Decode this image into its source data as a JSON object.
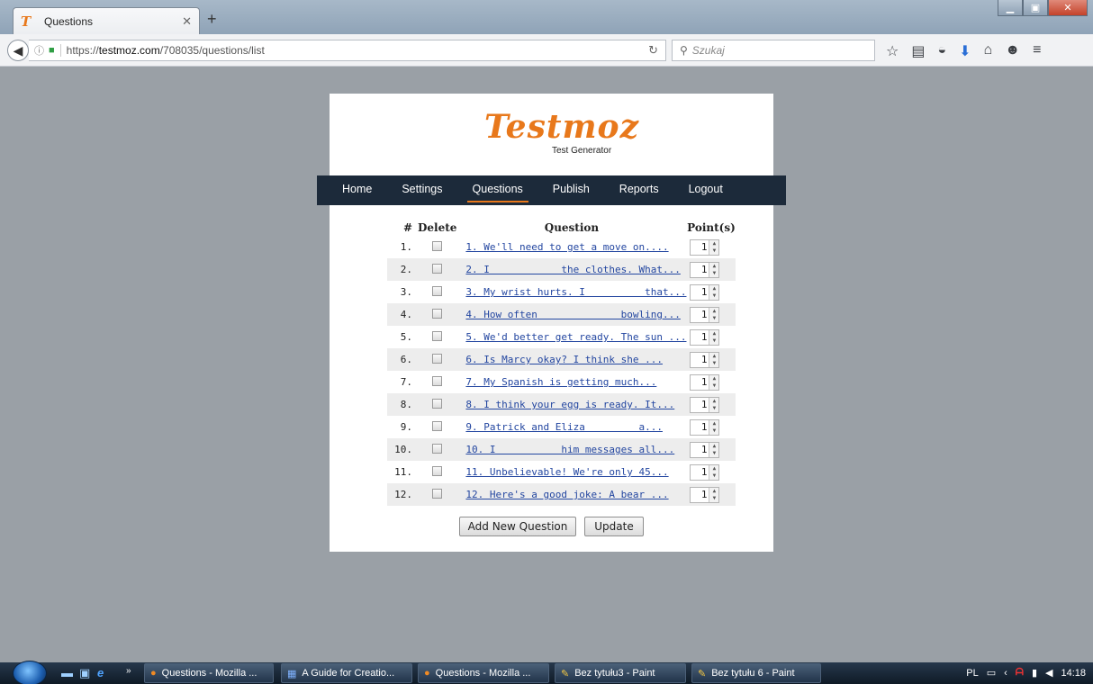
{
  "browser": {
    "tab_title": "Questions",
    "url_prefix": "https://",
    "url_domain": "testmoz.com",
    "url_path": "/708035/questions/list",
    "search_placeholder": "Szukaj"
  },
  "site": {
    "logo": "Testmoz",
    "subtitle": "Test Generator",
    "menu": [
      "Home",
      "Settings",
      "Questions",
      "Publish",
      "Reports",
      "Logout"
    ],
    "active_menu": "Questions"
  },
  "table": {
    "headers": [
      "#",
      "Delete",
      "Question",
      "Point(s)"
    ],
    "rows": [
      {
        "num": "1.",
        "text": "1. We'll need to get a move on....",
        "points": "1"
      },
      {
        "num": "2.",
        "text": "2. I            the clothes. What...",
        "points": "1"
      },
      {
        "num": "3.",
        "text": "3. My wrist hurts. I          that...",
        "points": "1"
      },
      {
        "num": "4.",
        "text": "4. How often              bowling...",
        "points": "1"
      },
      {
        "num": "5.",
        "text": "5. We'd better get ready. The sun ...",
        "points": "1"
      },
      {
        "num": "6.",
        "text": "6. Is Marcy okay? I think she ...",
        "points": "1"
      },
      {
        "num": "7.",
        "text": "7. My Spanish is getting much...",
        "points": "1"
      },
      {
        "num": "8.",
        "text": "8. I think your egg is ready. It...",
        "points": "1"
      },
      {
        "num": "9.",
        "text": "9. Patrick and Eliza         a...",
        "points": "1"
      },
      {
        "num": "10.",
        "text": "10. I           him messages all...",
        "points": "1"
      },
      {
        "num": "11.",
        "text": "11. Unbelievable! We're only 45...",
        "points": "1"
      },
      {
        "num": "12.",
        "text": "12. Here's a good joke: A bear ...",
        "points": "1"
      }
    ]
  },
  "buttons": {
    "add": "Add New Question",
    "update": "Update"
  },
  "taskbar": {
    "tasks": [
      "Questions - Mozilla ...",
      "A Guide for Creatio...",
      "Questions - Mozilla ...",
      "Bez tytułu3 - Paint",
      "Bez tytułu 6 - Paint"
    ],
    "lang": "PL",
    "time": "14:18"
  }
}
